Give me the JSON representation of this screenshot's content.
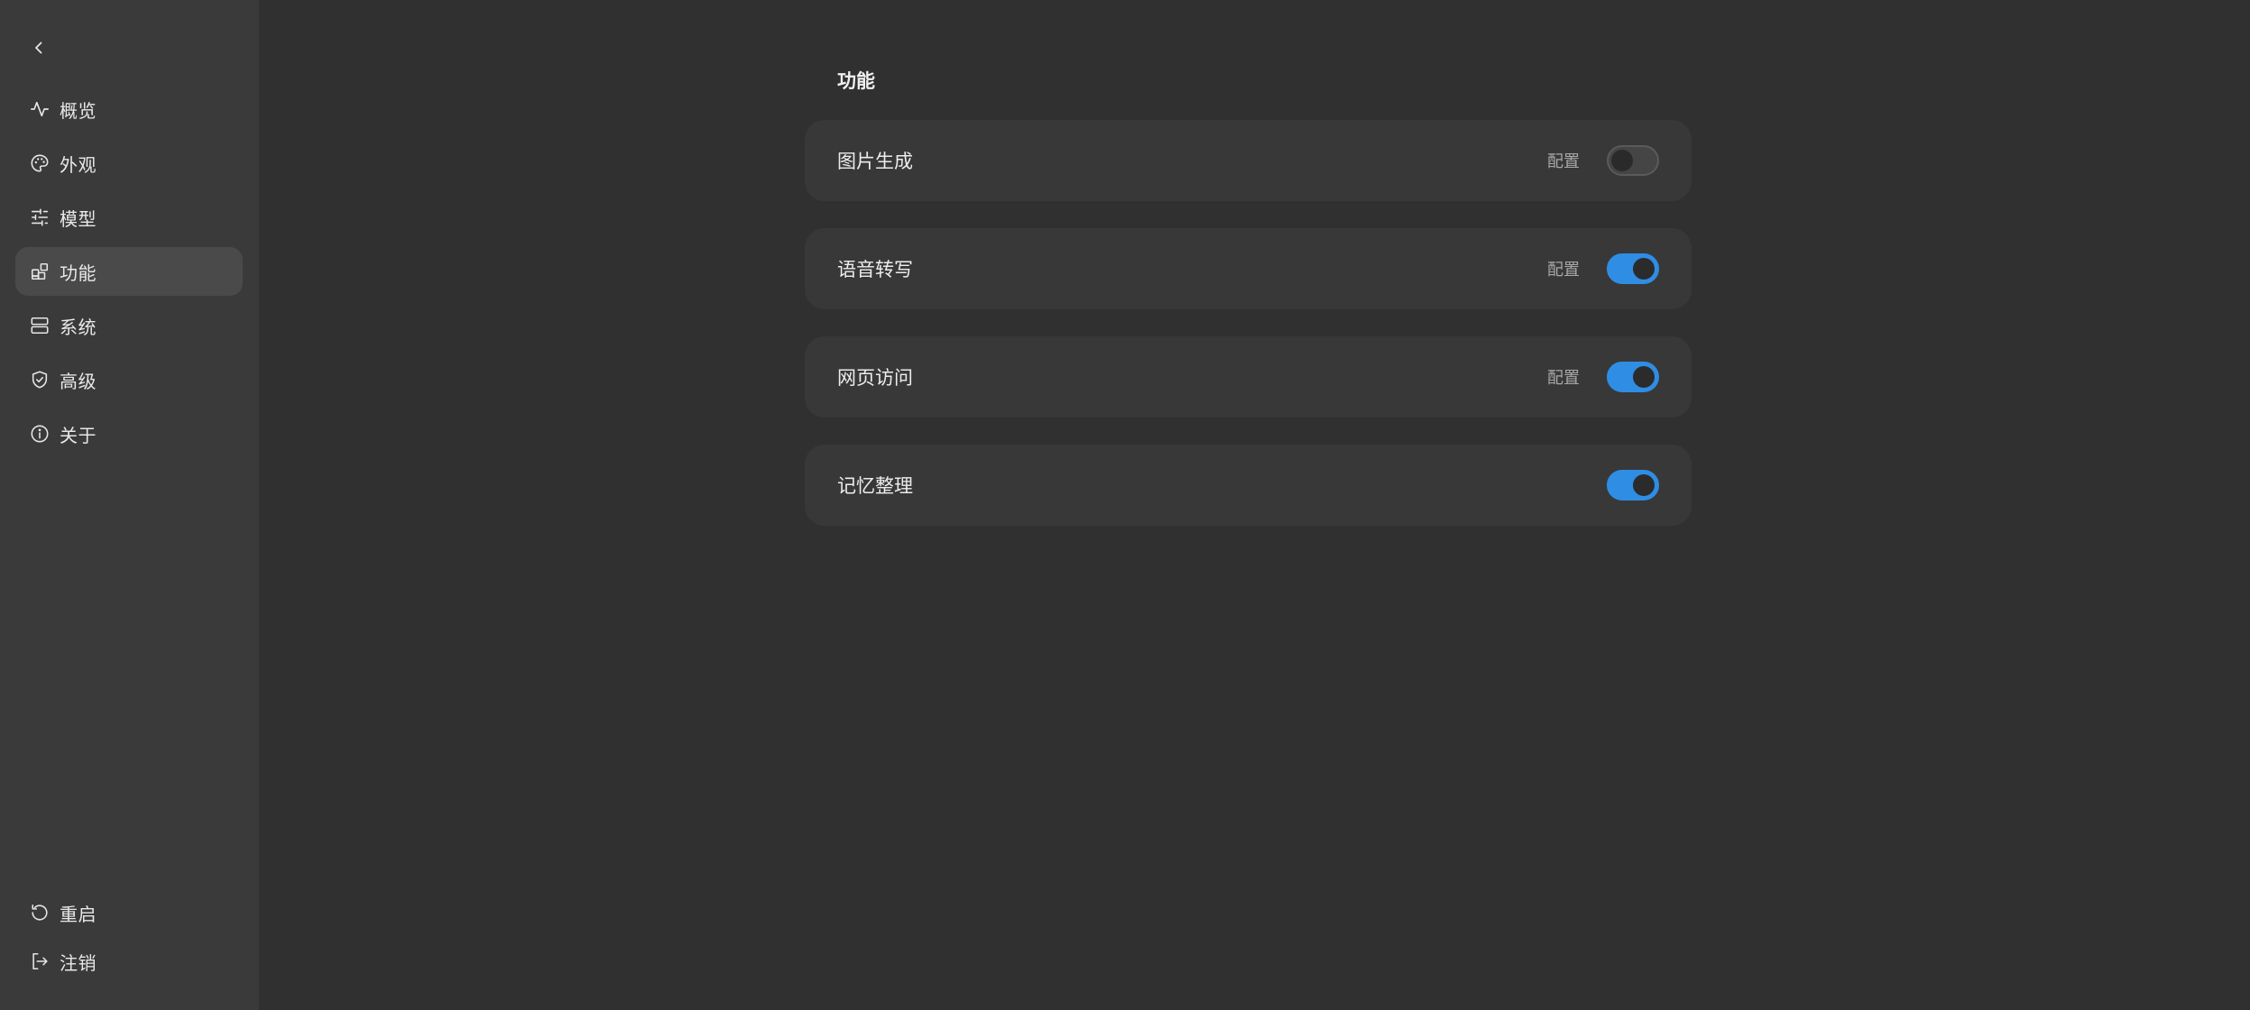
{
  "sidebar": {
    "back_icon": "chevron-left-icon",
    "items": [
      {
        "label": "概览",
        "icon": "activity-icon",
        "active": false
      },
      {
        "label": "外观",
        "icon": "palette-icon",
        "active": false
      },
      {
        "label": "模型",
        "icon": "sliders-icon",
        "active": false
      },
      {
        "label": "功能",
        "icon": "blocks-icon",
        "active": true
      },
      {
        "label": "系统",
        "icon": "server-icon",
        "active": false
      },
      {
        "label": "高级",
        "icon": "shield-icon",
        "active": false
      },
      {
        "label": "关于",
        "icon": "info-icon",
        "active": false
      }
    ],
    "bottom": [
      {
        "label": "重启",
        "icon": "restart-icon"
      },
      {
        "label": "注销",
        "icon": "logout-icon"
      }
    ]
  },
  "main": {
    "title": "功能",
    "features": [
      {
        "label": "图片生成",
        "config_label": "配置",
        "enabled": false
      },
      {
        "label": "语音转写",
        "config_label": "配置",
        "enabled": true
      },
      {
        "label": "网页访问",
        "config_label": "配置",
        "enabled": true
      },
      {
        "label": "记忆整理",
        "config_label": "",
        "enabled": true
      }
    ]
  },
  "colors": {
    "sidebar_bg": "#3a3a3a",
    "main_bg": "#303030",
    "card_bg": "#383838",
    "active_item_bg": "#4a4a4a",
    "toggle_on": "#2f8de4",
    "toggle_off": "#454545"
  }
}
